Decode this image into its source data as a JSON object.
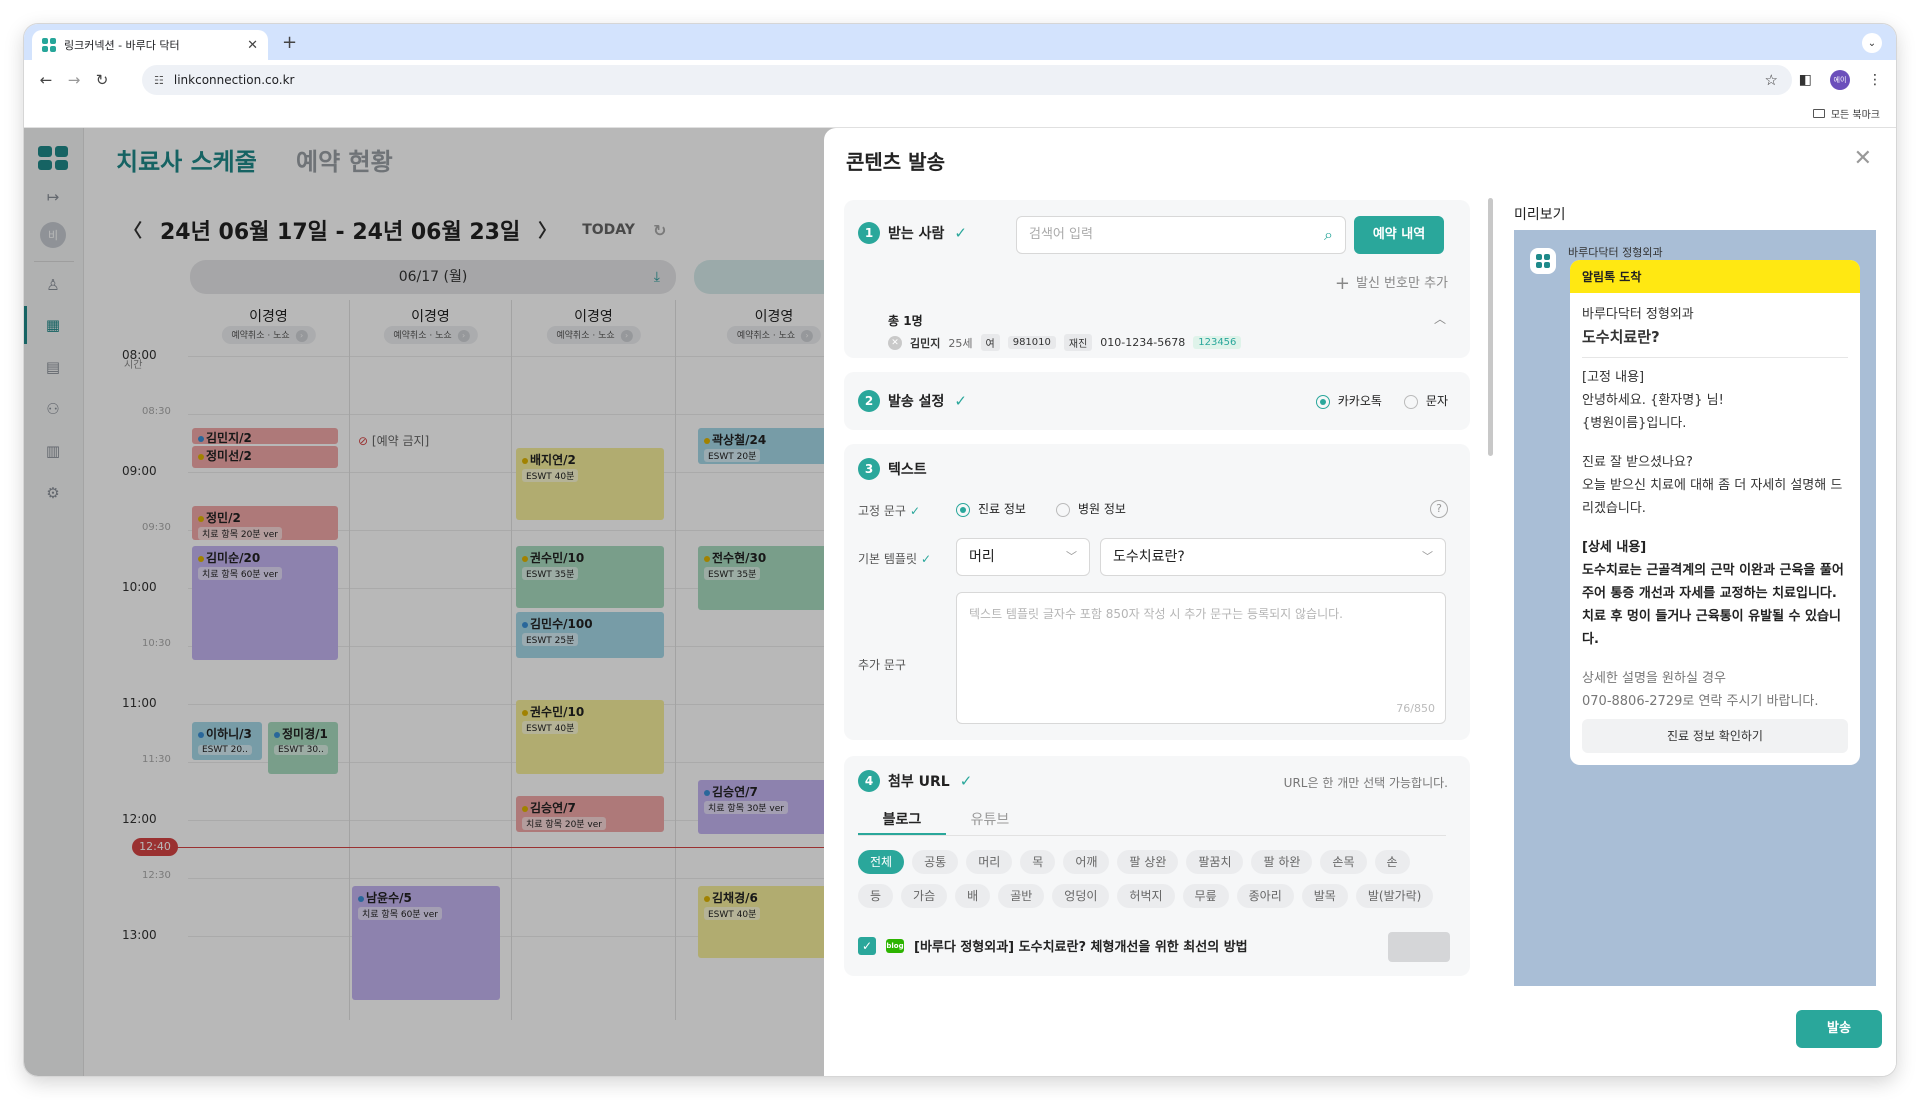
{
  "browser": {
    "tab_title": "링크커넥션 - 바루다 닥터",
    "url": "linkconnection.co.kr",
    "bookmark_label": "모든 북마크",
    "profile_initials": "에이"
  },
  "sidebar": {
    "avatar_initial": "비",
    "icons": [
      "expand-icon",
      "user-icon",
      "calendar-icon",
      "clipboard-icon",
      "group-icon",
      "chart-icon",
      "gear-icon"
    ]
  },
  "schedule": {
    "title": "치료사 스케줄",
    "subtitle": "예약 현황",
    "date_range": "24년 06월 17일 - 24년 06월 23일",
    "today_label": "TODAY",
    "day_header": "06/17 (월)",
    "time_header": "시간",
    "columns": [
      {
        "name": "이경영",
        "sub": "예약취소 · 노쇼"
      },
      {
        "name": "이경영",
        "sub": "예약취소 · 노쇼"
      },
      {
        "name": "이경영",
        "sub": "예약취소 · 노쇼"
      },
      {
        "name": "이경영",
        "sub": "예약취소 · 노쇼"
      }
    ],
    "times": [
      "08:00",
      "08:30",
      "09:00",
      "09:30",
      "10:00",
      "10:30",
      "11:00",
      "11:30",
      "12:00",
      "12:30",
      "13:00"
    ],
    "now_label": "12:40",
    "blocked_label": "[예약 금지]",
    "appointments": [
      {
        "name": "김민지/2",
        "sub": ""
      },
      {
        "name": "정미선/2",
        "sub": ""
      },
      {
        "name": "정민/2",
        "sub": "치료 항목 20분 ver"
      },
      {
        "name": "김미순/20",
        "sub": "치료 항목 60분 ver"
      },
      {
        "name": "이하니/3",
        "sub": "ESWT 20.."
      },
      {
        "name": "정미경/1",
        "sub": "ESWT 30.."
      },
      {
        "name": "배지연/2",
        "sub": "ESWT 40분"
      },
      {
        "name": "권수민/10",
        "sub": "ESWT 35분"
      },
      {
        "name": "김민수/100",
        "sub": "ESWT 25분"
      },
      {
        "name": "권수민/10",
        "sub": "ESWT 40분"
      },
      {
        "name": "김승연/7",
        "sub": "치료 항목 20분 ver"
      },
      {
        "name": "남윤수/5",
        "sub": "치료 항목 60분 ver"
      },
      {
        "name": "곽상철/24",
        "sub": "ESWT 20분"
      },
      {
        "name": "전수현/30",
        "sub": "ESWT 35분"
      },
      {
        "name": "김승연/7",
        "sub": "치료 항목 30분 ver"
      },
      {
        "name": "김채경/6",
        "sub": "ESWT 40분"
      }
    ]
  },
  "modal": {
    "title": "콘텐츠 발송",
    "recipient": {
      "step": "1",
      "label": "받는 사람",
      "search_placeholder": "검색어 입력",
      "history_button": "예약 내역",
      "add_sender": "발신 번호만 추가",
      "total": "총 1명",
      "patient": {
        "name": "김민지",
        "age": "25세",
        "gender": "여",
        "chart_no": "981010",
        "visit": "재진",
        "phone": "010-1234-5678",
        "code": "123456"
      }
    },
    "send_settings": {
      "step": "2",
      "label": "발송 설정",
      "options": [
        "카카오톡",
        "문자"
      ],
      "selected": "카카오톡"
    },
    "text": {
      "step": "3",
      "label": "텍스트",
      "fixed_label": "고정 문구",
      "fixed_options": [
        "진료 정보",
        "병원 정보"
      ],
      "template_label": "기본 템플릿",
      "template_part": "머리",
      "template_name": "도수치료란?",
      "extra_label": "추가 문구",
      "extra_placeholder": "텍스트 템플릿 글자수 포함 850자 작성 시 추가 문구는 등록되지 않습니다.",
      "counter": "76/850"
    },
    "url": {
      "step": "4",
      "label": "첨부 URL",
      "note": "URL은 한 개만 선택 가능합니다.",
      "tabs": [
        "블로그",
        "유튜브"
      ],
      "chips_row1": [
        "전체",
        "공통",
        "머리",
        "목",
        "어깨",
        "팔 상완",
        "팔꿈치",
        "팔 하완",
        "손목",
        "손"
      ],
      "chips_row2": [
        "등",
        "가슴",
        "배",
        "골반",
        "엉덩이",
        "허벅지",
        "무릎",
        "종아리",
        "발목",
        "발(발가락)"
      ],
      "blog_icon": "blog",
      "blog_title": "[바루다 정형외과] 도수치료란? 체형개선을 위한 최선의 방법"
    },
    "preview": {
      "label": "미리보기",
      "sender": "바루다닥터 정형외과",
      "header": "알림톡 도착",
      "hospital": "바루다닥터 정형외과",
      "title": "도수치료란?",
      "fixed_head": "[고정 내용]",
      "fixed_l1": "안녕하세요. {환자명} 님!",
      "fixed_l2": "{병원이름}입니다.",
      "body_l1": "진료 잘 받으셨나요?",
      "body_l2": "오늘 받으신 치료에 대해 좀 더 자세히 설명해 드리겠습니다.",
      "detail_head": "[상세 내용]",
      "detail_body": "도수치료는 근골격계의 근막 이완과 근육을 풀어주어 통증 개선과 자세를 교정하는 치료입니다.",
      "detail_body2": "치료 후 멍이 들거나 근육통이 유발될 수 있습니다.",
      "contact_l1": "상세한 설명을 원하실 경우",
      "contact_l2": "070-8806-2729로 연락 주시기 바랍니다.",
      "action": "진료 정보 확인하기"
    },
    "send_button": "발송"
  }
}
